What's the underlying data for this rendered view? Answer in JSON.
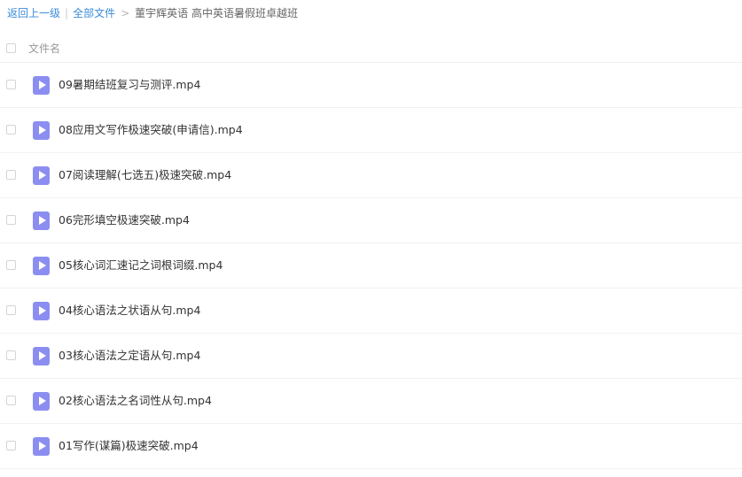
{
  "breadcrumb": {
    "back": "返回上一级",
    "all_files": "全部文件",
    "separator": ">",
    "current": "董宇辉英语 高中英语暑假班卓越班"
  },
  "list_header": {
    "name_label": "文件名"
  },
  "files": [
    {
      "name": "09暑期结班复习与测评.mp4",
      "icon": "video-file-icon"
    },
    {
      "name": "08应用文写作极速突破(申请信).mp4",
      "icon": "video-file-icon"
    },
    {
      "name": "07阅读理解(七选五)极速突破.mp4",
      "icon": "video-file-icon"
    },
    {
      "name": "06完形填空极速突破.mp4",
      "icon": "video-file-icon"
    },
    {
      "name": "05核心词汇速记之词根词缀.mp4",
      "icon": "video-file-icon"
    },
    {
      "name": "04核心语法之状语从句.mp4",
      "icon": "video-file-icon"
    },
    {
      "name": "03核心语法之定语从句.mp4",
      "icon": "video-file-icon"
    },
    {
      "name": "02核心语法之名词性从句.mp4",
      "icon": "video-file-icon"
    },
    {
      "name": "01写作(谋篇)极速突破.mp4",
      "icon": "video-file-icon"
    }
  ],
  "colors": {
    "link": "#3b8cd8",
    "icon": "#8b8ef0",
    "text": "#333333",
    "muted": "#999999"
  }
}
